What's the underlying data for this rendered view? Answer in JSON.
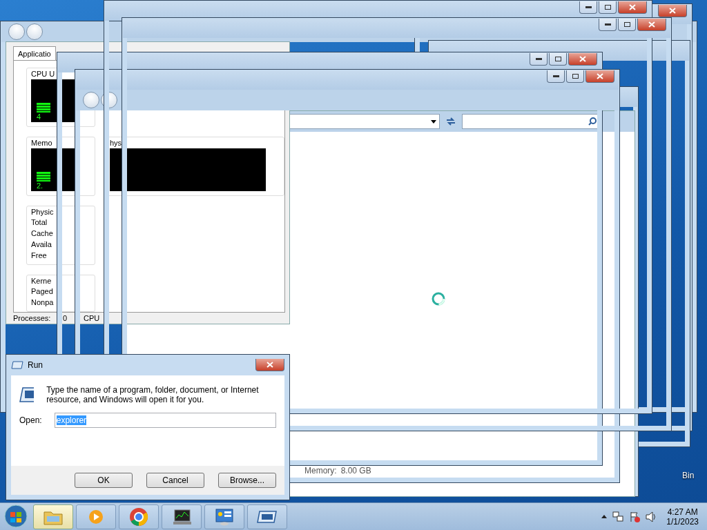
{
  "task_manager": {
    "tabs": [
      {
        "label": "Applicatio",
        "selected": true
      }
    ],
    "cpu_group": {
      "title": "CPU U",
      "reading": "4"
    },
    "memory_group": {
      "title": "Memo",
      "reading": "2."
    },
    "history_group": {
      "title": "hys"
    },
    "physical_memory": {
      "title": "Physic",
      "rows": [
        "Total",
        "Cache",
        "Availa",
        "Free"
      ]
    },
    "kernel_memory": {
      "title": "Kerne",
      "rows": [
        "Paged",
        "Nonpa"
      ]
    },
    "status": [
      "Processes:",
      "0",
      "CPU"
    ]
  },
  "explorer": {
    "memory_label": "Memory:",
    "memory_value": "8.00 GB",
    "loading": true
  },
  "run_dialog": {
    "title": "Run",
    "prompt": "Type the name of a program, folder, document, or Internet resource, and Windows will open it for you.",
    "open_label": "Open:",
    "value": "explorer",
    "value_selected": true,
    "buttons": [
      "OK",
      "Cancel",
      "Browse..."
    ]
  },
  "desktop": {
    "icon_label": "Bin"
  },
  "taskbar": {
    "apps": [
      {
        "kind": "folder",
        "selected": true
      },
      {
        "kind": "player",
        "selected": false
      },
      {
        "kind": "browser",
        "selected": false
      },
      {
        "kind": "monitor",
        "selected": false
      },
      {
        "kind": "panel",
        "selected": false
      },
      {
        "kind": "run",
        "selected": false
      }
    ],
    "clock": {
      "time": "4:27 AM",
      "date": "1/1/2023"
    }
  }
}
